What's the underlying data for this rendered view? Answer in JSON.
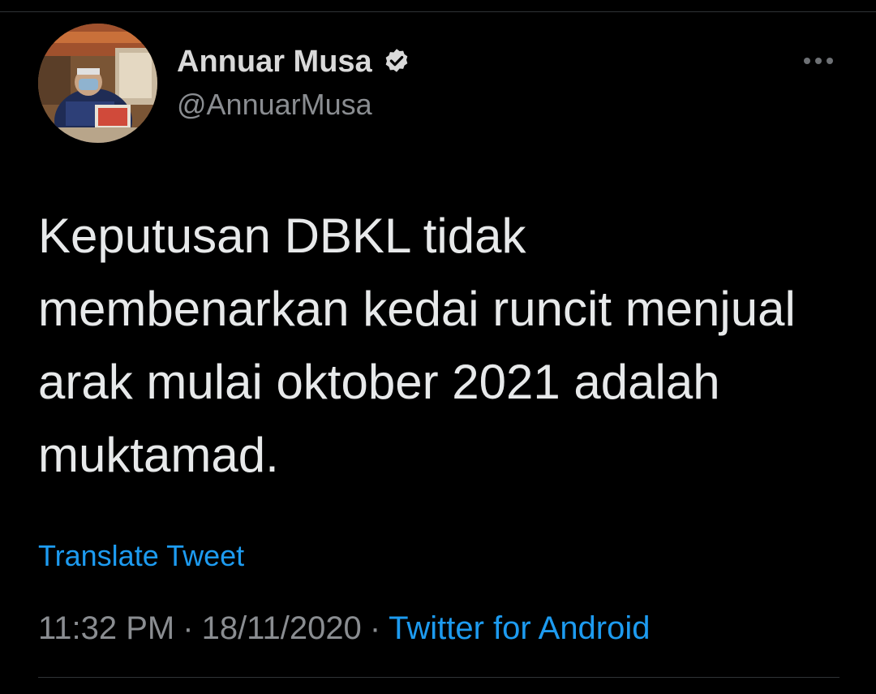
{
  "tweet": {
    "author": {
      "display_name": "Annuar Musa",
      "handle": "@AnnuarMusa",
      "verified": true,
      "avatar_icon": "profile-photo"
    },
    "text_lines": [
      "Keputusan DBKL tidak",
      "membenarkan kedai runcit menjual",
      "arak mulai oktober 2021 adalah",
      "muktamad."
    ],
    "translate_label": "Translate Tweet",
    "time": "11:32 PM",
    "date": "18/11/2020",
    "separator": "·",
    "source": "Twitter for Android",
    "more_icon": "more-horizontal-icon"
  },
  "colors": {
    "background": "#000000",
    "primary_text": "#e7e9ea",
    "secondary_text": "#8a8d91",
    "link": "#1d9bf0",
    "divider": "#2f3336"
  }
}
